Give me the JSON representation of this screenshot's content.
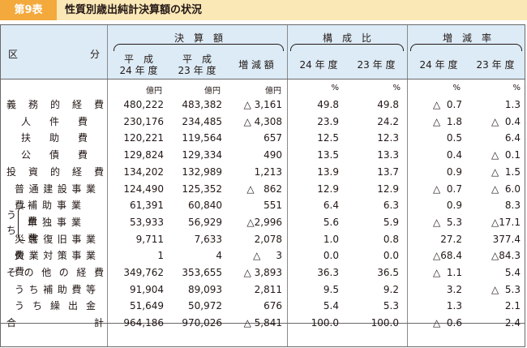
{
  "title": {
    "tag": "第9表",
    "text": "性質別歳出純計決算額の状況"
  },
  "header": {
    "kubun": [
      "区",
      "分"
    ],
    "groups": {
      "kessan": "決　算　額",
      "kosei": "構　成　比",
      "zogen": "増　減　率"
    },
    "cols": {
      "h24": [
        "平　成",
        "24 年 度"
      ],
      "h23": [
        "平　成",
        "23 年 度"
      ],
      "zogen_gaku": "増 減 額",
      "k24": "24 年 度",
      "k23": "23 年 度",
      "r24": "24 年 度",
      "r23": "23 年 度"
    },
    "units": [
      "億円",
      "億円",
      "億円",
      "%",
      "%",
      "%",
      "%"
    ]
  },
  "uchi_label": "うち",
  "rows": [
    {
      "label": "義務的経費",
      "v": [
        "480,222",
        "483,382",
        "△ 3,161",
        "49.8",
        "49.8",
        "△  0.7",
        "1.3"
      ]
    },
    {
      "label": "人件費",
      "v": [
        "230,176",
        "234,485",
        "△ 4,308",
        "23.9",
        "24.2",
        "△  1.8",
        "△  0.4"
      ]
    },
    {
      "label": "扶助費",
      "v": [
        "120,221",
        "119,564",
        "657",
        "12.5",
        "12.3",
        "0.5",
        "6.4"
      ]
    },
    {
      "label": "公債費",
      "v": [
        "129,824",
        "129,334",
        "490",
        "13.5",
        "13.3",
        "0.4",
        "△  0.1"
      ]
    },
    {
      "label": "投資的経費",
      "v": [
        "134,202",
        "132,989",
        "1,213",
        "13.9",
        "13.7",
        "0.9",
        "△  1.5"
      ]
    },
    {
      "label": "普通建設事業費",
      "v": [
        "124,490",
        "125,352",
        "△   862",
        "12.9",
        "12.9",
        "△  0.7",
        "△  6.0"
      ]
    },
    {
      "label": "補助事業費",
      "v": [
        "61,391",
        "60,840",
        "551",
        "6.4",
        "6.3",
        "0.9",
        "8.3"
      ]
    },
    {
      "label": "単独事業費",
      "v": [
        "53,933",
        "56,929",
        "△2,996",
        "5.6",
        "5.9",
        "△  5.3",
        "△17.1"
      ]
    },
    {
      "label": "災害復旧事業費",
      "v": [
        "9,711",
        "7,633",
        "2,078",
        "1.0",
        "0.8",
        "27.2",
        "377.4"
      ]
    },
    {
      "label": "失業対策事業費",
      "v": [
        "1",
        "4",
        "△     3",
        "0.0",
        "0.0",
        "△68.4",
        "△84.3"
      ]
    },
    {
      "label": "その他の経費",
      "v": [
        "349,762",
        "353,655",
        "△ 3,893",
        "36.3",
        "36.5",
        "△  1.1",
        "5.4"
      ]
    },
    {
      "label": "うち補助費等",
      "v": [
        "91,904",
        "89,093",
        "2,811",
        "9.5",
        "9.2",
        "3.2",
        "△  5.3"
      ]
    },
    {
      "label": "うち繰出金",
      "v": [
        "51,649",
        "50,972",
        "676",
        "5.4",
        "5.3",
        "1.3",
        "2.1"
      ]
    },
    {
      "label": "合計",
      "v": [
        "964,186",
        "970,026",
        "△ 5,841",
        "100.0",
        "100.0",
        "△  0.6",
        "2.4"
      ]
    }
  ]
}
